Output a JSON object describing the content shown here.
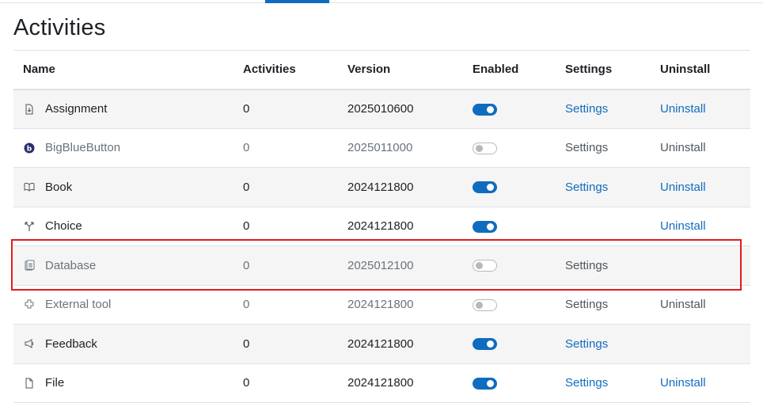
{
  "page": {
    "title": "Activities"
  },
  "table": {
    "headers": {
      "name": "Name",
      "activities": "Activities",
      "version": "Version",
      "enabled": "Enabled",
      "settings": "Settings",
      "uninstall": "Uninstall"
    },
    "rows": [
      {
        "name": "Assignment",
        "icon": "assignment-icon",
        "activities": "0",
        "version": "2025010600",
        "enabled": true,
        "settings": "Settings",
        "settings_link": true,
        "uninstall": "Uninstall",
        "uninstall_link": true
      },
      {
        "name": "BigBlueButton",
        "icon": "bigbluebutton-icon",
        "activities": "0",
        "version": "2025011000",
        "enabled": false,
        "settings": "Settings",
        "settings_link": false,
        "uninstall": "Uninstall",
        "uninstall_link": false
      },
      {
        "name": "Book",
        "icon": "book-icon",
        "activities": "0",
        "version": "2024121800",
        "enabled": true,
        "settings": "Settings",
        "settings_link": true,
        "uninstall": "Uninstall",
        "uninstall_link": true
      },
      {
        "name": "Choice",
        "icon": "choice-icon",
        "activities": "0",
        "version": "2024121800",
        "enabled": true,
        "settings": "",
        "settings_link": false,
        "uninstall": "Uninstall",
        "uninstall_link": true
      },
      {
        "name": "Database",
        "icon": "database-icon",
        "activities": "0",
        "version": "2025012100",
        "enabled": false,
        "settings": "Settings",
        "settings_link": false,
        "uninstall": "",
        "uninstall_link": false
      },
      {
        "name": "External tool",
        "icon": "external-tool-icon",
        "activities": "0",
        "version": "2024121800",
        "enabled": false,
        "settings": "Settings",
        "settings_link": false,
        "uninstall": "Uninstall",
        "uninstall_link": false
      },
      {
        "name": "Feedback",
        "icon": "feedback-icon",
        "activities": "0",
        "version": "2024121800",
        "enabled": true,
        "settings": "Settings",
        "settings_link": true,
        "uninstall": "",
        "uninstall_link": false
      },
      {
        "name": "File",
        "icon": "file-icon",
        "activities": "0",
        "version": "2024121800",
        "enabled": true,
        "settings": "Settings",
        "settings_link": true,
        "uninstall": "Uninstall",
        "uninstall_link": true
      }
    ]
  },
  "colors": {
    "link": "#0f6cbf",
    "toggle_on": "#0f6cbf",
    "highlight_border": "#e01b1b",
    "bigbluebutton_icon": "#2b2f6f"
  }
}
